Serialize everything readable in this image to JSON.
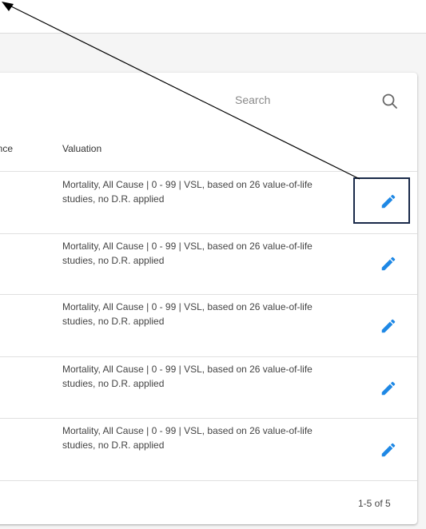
{
  "search": {
    "placeholder": "Search"
  },
  "table": {
    "columns": {
      "prev": "ence",
      "valuation": "Valuation"
    },
    "rows": [
      {
        "valuation": "Mortality, All Cause | 0 - 99 | VSL, based on 26 value-of-life studies, no D.R. applied"
      },
      {
        "valuation": "Mortality, All Cause | 0 - 99 | VSL, based on 26 value-of-life studies, no D.R. applied"
      },
      {
        "valuation": "Mortality, All Cause | 0 - 99 | VSL, based on 26 value-of-life studies, no D.R. applied"
      },
      {
        "valuation": "Mortality, All Cause | 0 - 99 | VSL, based on 26 value-of-life studies, no D.R. applied"
      },
      {
        "valuation": "Mortality, All Cause | 0 - 99 | VSL, based on 26 value-of-life studies, no D.R. applied"
      }
    ]
  },
  "pagination": {
    "range": "1-5 of 5"
  },
  "icons": {
    "search": "search-icon",
    "edit": "pencil-icon",
    "pointer": "arrow-pointer-icon"
  },
  "colors": {
    "accent": "#1e88e5",
    "focus": "#1a2a4a"
  }
}
